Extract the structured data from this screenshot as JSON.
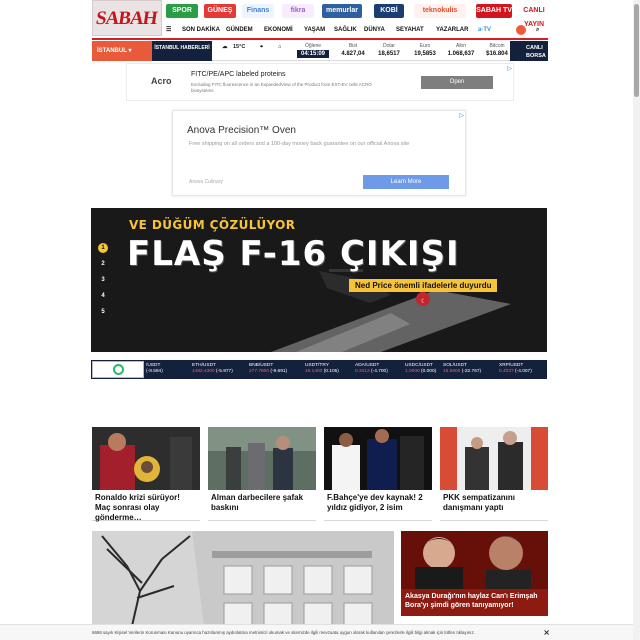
{
  "logo": {
    "text": "SABAH"
  },
  "brands": [
    {
      "label": "SPOR",
      "color": "#2b9d46"
    },
    {
      "label": "GÜNEŞ",
      "color": "#e53935"
    },
    {
      "label": "Finans",
      "color": "#3f7fd2"
    },
    {
      "label": "fikra",
      "color": "#a45ad3"
    },
    {
      "label": "memurlar",
      "color": "#2e5f9f"
    },
    {
      "label": "KOBİ",
      "color": "#1a3d73"
    },
    {
      "label": "teknokulis",
      "color": "#e94d2f"
    },
    {
      "label": "SABAH TV",
      "color": "#d3161d"
    },
    {
      "label": "CANLI YAYIN",
      "color": "#d3161d"
    }
  ],
  "nav": {
    "items": [
      "SON DAKİKA",
      "GÜNDEM",
      "EKONOMİ",
      "DÜNYA",
      "YAŞAM",
      "SAĞLIK",
      "DÜNYA",
      "SEYAHAT",
      "YAZARLAR",
      "a-TV"
    ],
    "search_icon": "search-icon",
    "menu_icon": "hamburger-menu-icon"
  },
  "info": {
    "city": "İSTANBUL",
    "news": "İSTANBUL HABERLERİ",
    "weather": "15°C",
    "prayer_label": "Öğlene",
    "prayer_time": "04:15:09",
    "tickers": [
      {
        "name": "Bist",
        "value": "4.827,04",
        "trend": "up"
      },
      {
        "name": "Dolar",
        "value": "18,6517",
        "trend": "up"
      },
      {
        "name": "Euro",
        "value": "19,5853",
        "trend": "down"
      },
      {
        "name": "Altın",
        "value": "1.068,637",
        "trend": "down"
      },
      {
        "name": "Bitcoin",
        "value": "$16.804",
        "trend": "up"
      }
    ],
    "live": "CANLI BORSA"
  },
  "ad1": {
    "logo": "Acro",
    "title": "FITC/PE/APC labeled proteins",
    "desc": "Excluding FITC fluorescence in an ExpandedView of the Product from EXT-EV cells ACRO biosystems",
    "button": "Open"
  },
  "ad2": {
    "title": "Anova Precision™ Oven",
    "desc": "Free shipping on all orders and a 100-day money back guarantee on our official Anova site",
    "brand": "Anova Culinary",
    "button": "Learn More"
  },
  "hero": {
    "kicker": "VE DÜĞÜM ÇÖZÜLÜYOR",
    "title": "FLAŞ F-16 ÇIKIŞI",
    "subtitle": "Ned Price önemli ifadelerle duyurdu",
    "slides": [
      "1",
      "2",
      "3",
      "4",
      "5"
    ],
    "active": 0
  },
  "market": {
    "items": [
      {
        "pair": "/USDT",
        "value": "",
        "change": "(-8.594)"
      },
      {
        "pair": "ETH/USDT",
        "value": "1482.4300",
        "change": "(-5.977)"
      },
      {
        "pair": "BNB/USDT",
        "value": "277.7800",
        "change": "(-9.691)"
      },
      {
        "pair": "USDT/TRY",
        "value": "19.1400",
        "change": "(0.105)"
      },
      {
        "pair": "ADA/USDT",
        "value": "0.3412",
        "change": "(-4.700)"
      },
      {
        "pair": "USDC/USDT",
        "value": "1.0000",
        "change": "(0.000)"
      },
      {
        "pair": "SOL/USDT",
        "value": "16.5800",
        "change": "(-22.767)"
      },
      {
        "pair": "XRP/USDT",
        "value": "0.4037",
        "change": "(-4.007)"
      }
    ]
  },
  "cards": [
    {
      "title": "Ronaldo krizi sürüyor! Maç sonrası olay gönderme…"
    },
    {
      "title": "Alman darbecilere şafak baskını"
    },
    {
      "title": "F.Bahçe'ye dev kaynak! 2 yıldız gidiyor, 2 isim"
    },
    {
      "title": "PKK sempatizanını danışmanı yaptı"
    }
  ],
  "bottom_right": {
    "title": "Akasya Durağı'nın haylaz Can'ı Erimşah Bora'yı şimdi gören tanıyamıyor!"
  },
  "cookie": {
    "text": "6698 sayılı Kişisel Verilerin Korunması Kanunu uyarınca hazırlanmış aydınlatma metnimizi okumak ve sitemizde ilgili mevzuata uygun olarak kullanılan çerezlerle ilgili bilgi almak için lütfen tıklayınız.",
    "close": "×"
  }
}
